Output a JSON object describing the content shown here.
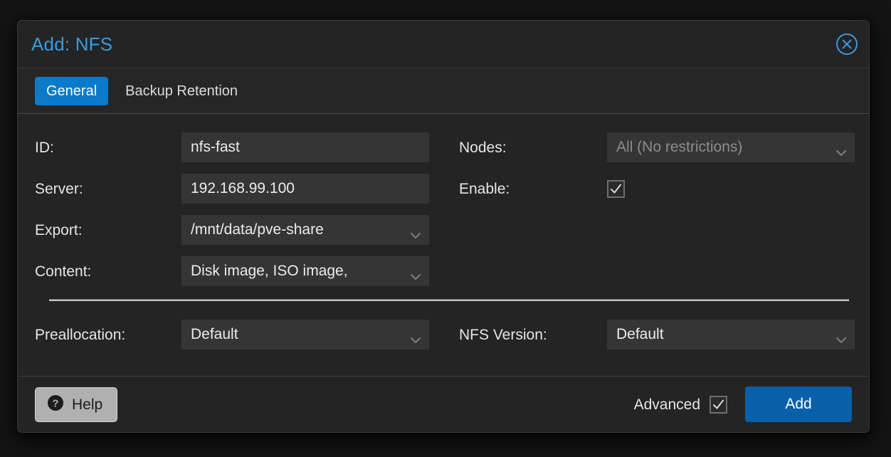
{
  "window": {
    "title": "Add: NFS",
    "close_icon": "close-circle-icon"
  },
  "tabs": [
    {
      "label": "General",
      "active": true
    },
    {
      "label": "Backup Retention",
      "active": false
    }
  ],
  "form": {
    "left": [
      {
        "label": "ID:",
        "value": "nfs-fast",
        "type": "text"
      },
      {
        "label": "Server:",
        "value": "192.168.99.100",
        "type": "text"
      },
      {
        "label": "Export:",
        "value": "/mnt/data/pve-share",
        "type": "select"
      },
      {
        "label": "Content:",
        "value": "Disk image, ISO image,",
        "type": "select"
      }
    ],
    "right": [
      {
        "label": "Nodes:",
        "value": "All (No restrictions)",
        "type": "select",
        "muted": true
      },
      {
        "label": "Enable:",
        "value": "",
        "type": "checkbox",
        "checked": true
      }
    ],
    "advanced_rows": [
      {
        "label": "Preallocation:",
        "value": "Default",
        "type": "select"
      },
      {
        "label": "NFS Version:",
        "value": "Default",
        "type": "select"
      }
    ]
  },
  "footer": {
    "help_label": "Help",
    "help_icon": "question-circle-icon",
    "advanced_label": "Advanced",
    "advanced_checked": true,
    "add_label": "Add"
  },
  "colors": {
    "accent_blue": "#0a7ac9",
    "title_blue": "#3a9ae0",
    "add_button_blue": "#0a60a8",
    "window_bg": "#242424",
    "field_bg": "#353535",
    "text": "#e6e6e6",
    "muted_text": "#8d8d8d"
  }
}
